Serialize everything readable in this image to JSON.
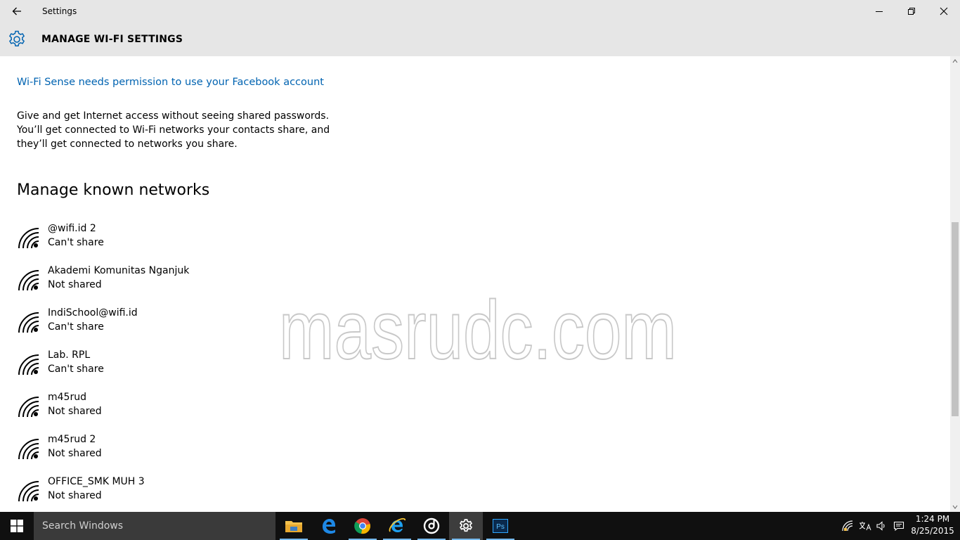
{
  "window": {
    "title": "Settings"
  },
  "header": {
    "title": "MANAGE WI-FI SETTINGS"
  },
  "content": {
    "permission_link": "Wi-Fi Sense needs permission to use your Facebook account",
    "description_lines": [
      "Give and get Internet access without seeing shared passwords.",
      "You’ll get connected to Wi-Fi networks your contacts share, and",
      "they’ll get connected to networks you share."
    ],
    "section_title": "Manage known networks",
    "networks": [
      {
        "name": "@wifi.id 2",
        "status": "Can't share"
      },
      {
        "name": "Akademi Komunitas Nganjuk",
        "status": "Not shared"
      },
      {
        "name": "IndiSchool@wifi.id",
        "status": "Can't share"
      },
      {
        "name": "Lab. RPL",
        "status": "Can't share"
      },
      {
        "name": "m45rud",
        "status": "Not shared"
      },
      {
        "name": "m45rud 2",
        "status": "Not shared"
      },
      {
        "name": "OFFICE_SMK MUH 3",
        "status": "Not shared"
      }
    ]
  },
  "watermark": "masrudc.com",
  "taskbar": {
    "search_placeholder": "Search Windows",
    "apps": [
      "file-explorer-icon",
      "edge-icon",
      "chrome-icon",
      "internet-explorer-icon",
      "groove-music-icon",
      "settings-icon",
      "photoshop-icon"
    ],
    "photoshop_label": "Ps",
    "clock": {
      "time": "1:24 PM",
      "date": "8/25/2015"
    }
  },
  "colors": {
    "accent_link": "#0063b1",
    "chrome_bg": "#e6e6e6",
    "taskbar_bg": "#101010",
    "taskbar_indicator": "#76b9ed"
  }
}
